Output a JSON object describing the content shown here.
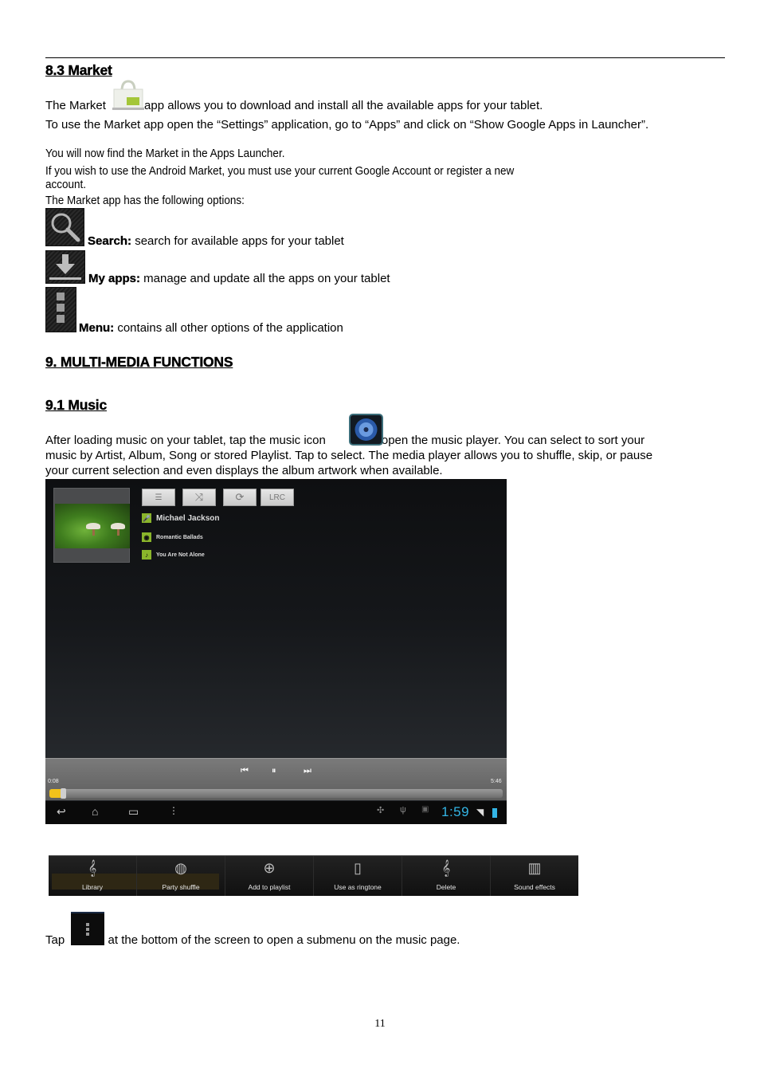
{
  "section_83": {
    "heading": "8.3 Market",
    "intro_before": "The Market",
    "intro_after": " app allows you to download and install all the available apps for your tablet.",
    "settings_line": "To use the Market app open the “Settings” application, go to “Apps” and click on “Show Google Apps in Launcher”.",
    "launcher_line": "You will now find the Market in the Apps Launcher.",
    "account_line1": "If you wish to use the Android Market, you must use your current Google Account or register a new",
    "account_line2": "account.",
    "options_intro": "The Market app has the following options:",
    "options": [
      {
        "icon": "search-icon",
        "label": "Search:",
        "text": " search for available apps for your tablet"
      },
      {
        "icon": "download-icon",
        "label": "My apps:",
        "text": " manage and update all the apps on your tablet"
      },
      {
        "icon": "menu-icon",
        "label": "Menu:",
        "text": " contains all other options of the application"
      }
    ]
  },
  "section_9": {
    "heading": "9. MULTI-MEDIA FUNCTIONS"
  },
  "section_91": {
    "heading": "9.1 Music",
    "line1_before": "After loading music on your tablet, tap the music icon ",
    "line1_after": " to open the music player. You can select to sort your",
    "line2": "music by Artist, Album, Song or stored Playlist. Tap to select. The media player allows you to shuffle, skip, or pause",
    "line3": "your current selection and even displays the album artwork when available."
  },
  "player": {
    "toolbar": [
      {
        "icon": "list-icon",
        "label": "☰"
      },
      {
        "icon": "shuffle-icon",
        "label": "⤨"
      },
      {
        "icon": "repeat-icon",
        "label": "⟳"
      },
      {
        "icon": "lyrics-button",
        "label": "LRC"
      }
    ],
    "artist": "Michael Jackson",
    "album": "Romantic Ballads",
    "song": "You Are Not Alone",
    "elapsed": "0:08",
    "duration": "5:46",
    "progress_fraction": 0.023,
    "clock": "1:59",
    "accent_color": "#33b5e5",
    "seek_color": "#f2c21b"
  },
  "submenu": {
    "items": [
      {
        "icon": "library-icon",
        "label": "Library",
        "glyph": "𝄞"
      },
      {
        "icon": "party-shuffle-icon",
        "label": "Party shuffle",
        "glyph": "◍"
      },
      {
        "icon": "add-to-playlist-icon",
        "label": "Add to playlist",
        "glyph": "⊕"
      },
      {
        "icon": "ringtone-icon",
        "label": "Use as ringtone",
        "glyph": "▯"
      },
      {
        "icon": "delete-icon",
        "label": "Delete",
        "glyph": "𝄞"
      },
      {
        "icon": "sound-effects-icon",
        "label": "Sound effects",
        "glyph": "▥"
      }
    ]
  },
  "tap_line": {
    "before": "Tap ",
    "after": " at the bottom of the screen to open a submenu on the music page."
  },
  "page_number": "11"
}
